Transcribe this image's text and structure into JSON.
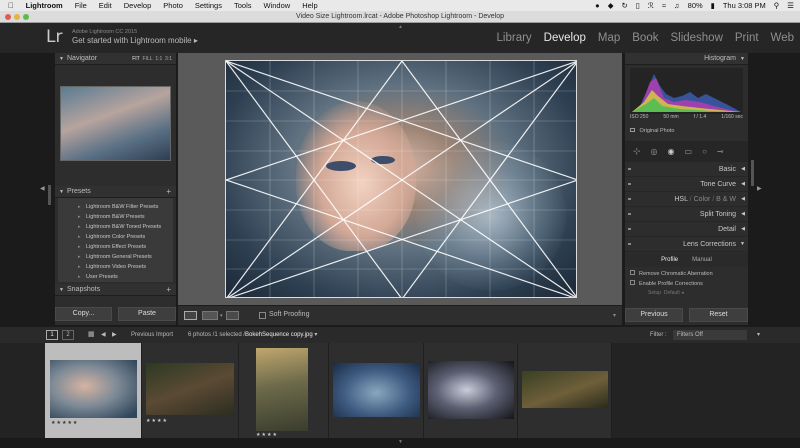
{
  "menubar": {
    "app": "Lightroom",
    "items": [
      "File",
      "Edit",
      "Develop",
      "Photo",
      "Settings",
      "Tools",
      "Window",
      "Help"
    ],
    "battery": "80%",
    "clock": "Thu 3:08 PM"
  },
  "window_title": "Video Size Lightroom.lrcat - Adobe Photoshop Lightroom - Develop",
  "identity": {
    "logo": "Lr",
    "version": "Adobe Lightroom CC 2015",
    "get_started": "Get started with Lightroom mobile",
    "get_started_arrow": "▸"
  },
  "modules": [
    "Library",
    "Develop",
    "Map",
    "Book",
    "Slideshow",
    "Print",
    "Web"
  ],
  "active_module": "Develop",
  "left_panel": {
    "navigator_title": "Navigator",
    "zoom_options": [
      "FIT",
      "FILL",
      "1:1",
      "3:1"
    ],
    "presets_title": "Presets",
    "presets": [
      "Lightroom B&W Filter Presets",
      "Lightroom B&W Presets",
      "Lightroom B&W Toned Presets",
      "Lightroom Color Presets",
      "Lightroom Effect Presets",
      "Lightroom General Presets",
      "Lightroom Video Presets",
      "User Presets"
    ],
    "snapshots_title": "Snapshots",
    "add_symbol": "+",
    "copy_label": "Copy...",
    "paste_label": "Paste"
  },
  "toolbar": {
    "soft_proofing": "Soft Proofing"
  },
  "right_panel": {
    "histogram_title": "Histogram",
    "iso": "ISO 250",
    "focal": "50 mm",
    "aperture": "f / 1.4",
    "shutter": "1/160 sec",
    "original_photo": "Original Photo",
    "sections": [
      "Basic",
      "Tone Curve",
      "Split Toning",
      "Detail",
      "Lens Corrections"
    ],
    "hsl_tabs": [
      "HSL",
      "Color",
      "B & W"
    ],
    "lens_tabs": [
      "Profile",
      "Manual"
    ],
    "lens_options": [
      "Remove Chromatic Aberration",
      "Enable Profile Corrections"
    ],
    "setup_label": "Setup",
    "setup_value": "Default",
    "previous_label": "Previous",
    "reset_label": "Reset"
  },
  "filmstrip_bar": {
    "page1": "1",
    "page2": "2",
    "source": "Previous Import",
    "count": "6 photos /1 selected /",
    "filename": "BokehSequence copy.jpg",
    "filter_label": "Filter :",
    "filter_value": "Filters Off"
  },
  "filmstrip": {
    "stars": [
      "★★★★★",
      "★★★★",
      "★★★★",
      "",
      "",
      ""
    ]
  },
  "colors": {
    "accent": "#e8e8e8",
    "panel": "#2d2d2d",
    "background": "#1b1b1b"
  }
}
